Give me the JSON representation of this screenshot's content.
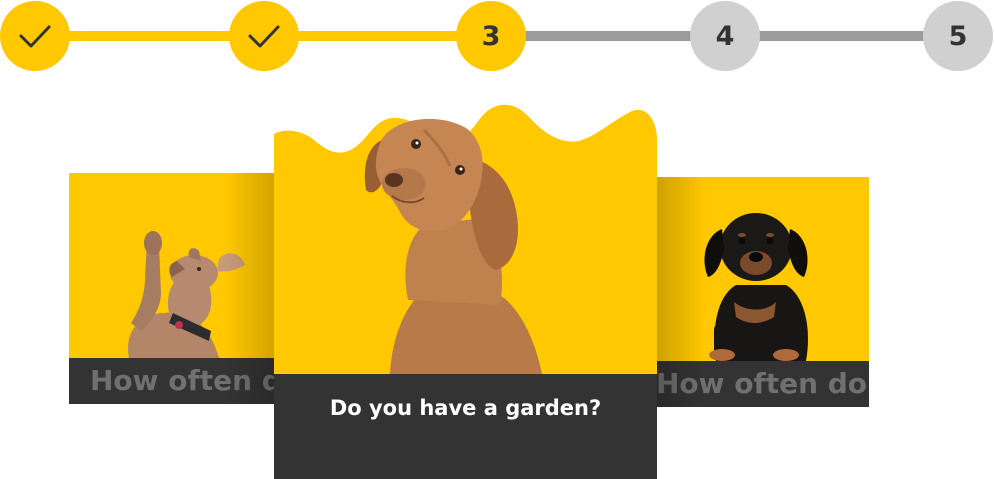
{
  "stepper": {
    "steps": [
      {
        "label": "",
        "state": "done",
        "icon": "checkmark-icon"
      },
      {
        "label": "",
        "state": "done",
        "icon": "checkmark-icon"
      },
      {
        "label": "3",
        "state": "current"
      },
      {
        "label": "4",
        "state": "todo"
      },
      {
        "label": "5",
        "state": "todo"
      }
    ],
    "colors": {
      "done": "#FFC800",
      "todo_track": "#9B9B9B",
      "todo_circle": "#D0D0D0",
      "text": "#333333"
    }
  },
  "cards": {
    "left": {
      "caption": "How often do",
      "photo": "dog-raising-paw"
    },
    "center": {
      "caption": "Do you have a garden?",
      "photo": "vizsla-dog-tilting-head"
    },
    "right": {
      "caption": "How often do",
      "photo": "black-tan-puppy"
    }
  },
  "colors": {
    "accent": "#FFC800",
    "caption_bg": "#333333"
  }
}
